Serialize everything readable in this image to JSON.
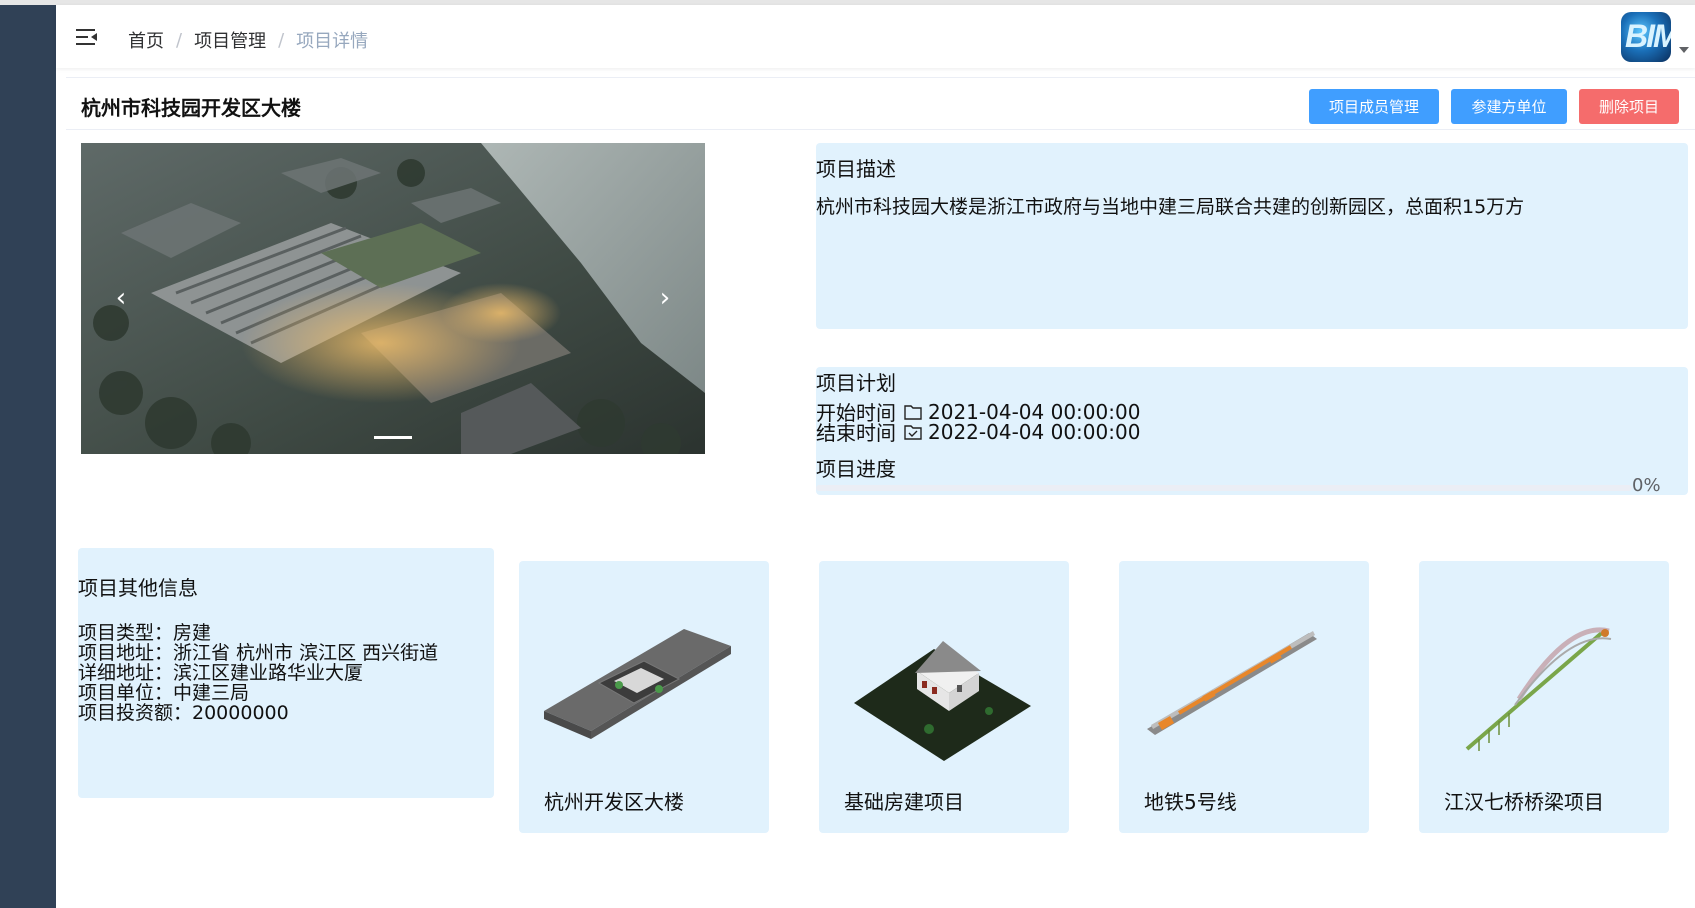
{
  "breadcrumb": {
    "items": [
      "首页",
      "项目管理",
      "项目详情"
    ]
  },
  "header": {
    "avatar_text": "BIM"
  },
  "project": {
    "title": "杭州市科技园开发区大楼",
    "buttons": {
      "members": "项目成员管理",
      "partners": "参建方单位",
      "delete": "删除项目"
    },
    "colors": {
      "primary": "#409eff",
      "danger": "#f56c6c",
      "panel": "#e1f2fd",
      "sidebar": "#304156"
    }
  },
  "carousel": {
    "prev_icon": "‹",
    "next_icon": "›"
  },
  "description": {
    "title": "项目描述",
    "text": "杭州市科技园大楼是浙江市政府与当地中建三局联合共建的创新园区，总面积15万方"
  },
  "plan": {
    "title": "项目计划",
    "start_label": "开始时间",
    "start_value": "2021-04-04 00:00:00",
    "end_label": "结束时间",
    "end_value": "2022-04-04 00:00:00",
    "progress_title": "项目进度",
    "progress_value": 0,
    "progress_text": "0%"
  },
  "other": {
    "title": "项目其他信息",
    "lines": [
      "项目类型：房建",
      "项目地址：浙江省 杭州市 滨江区 西兴街道",
      "详细地址：滨江区建业路华业大厦",
      "项目单位：中建三局",
      "项目投资额：20000000"
    ]
  },
  "models": [
    {
      "name": "杭州开发区大楼"
    },
    {
      "name": "基础房建项目"
    },
    {
      "name": "地铁5号线"
    },
    {
      "name": "江汉七桥桥梁项目"
    }
  ]
}
